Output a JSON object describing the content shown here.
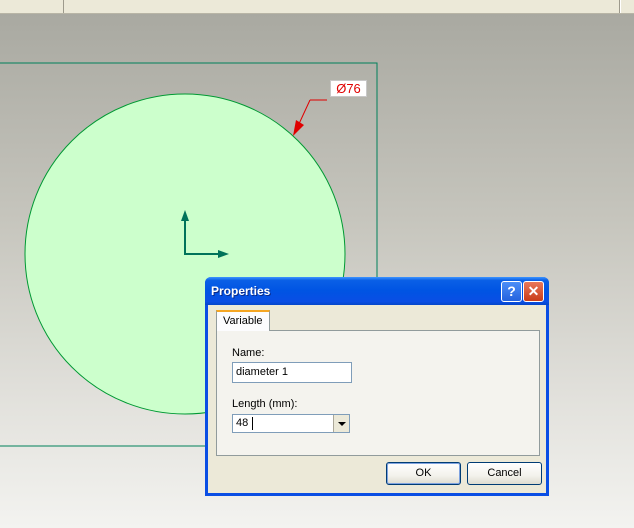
{
  "canvas": {
    "dimension_label": "Ø76"
  },
  "dialog": {
    "title": "Properties",
    "help_glyph": "?",
    "close_glyph": "✕",
    "tab_label": "Variable",
    "name_label": "Name:",
    "name_value": "diameter 1",
    "length_label": "Length (mm):",
    "length_value": "48",
    "ok_label": "OK",
    "cancel_label": "Cancel"
  },
  "colors": {
    "circle_fill": "#ccffcc",
    "circle_stroke": "#009933",
    "dimension_red": "#e00000",
    "axis_green": "#00735a",
    "title_blue": "#0054e3"
  }
}
